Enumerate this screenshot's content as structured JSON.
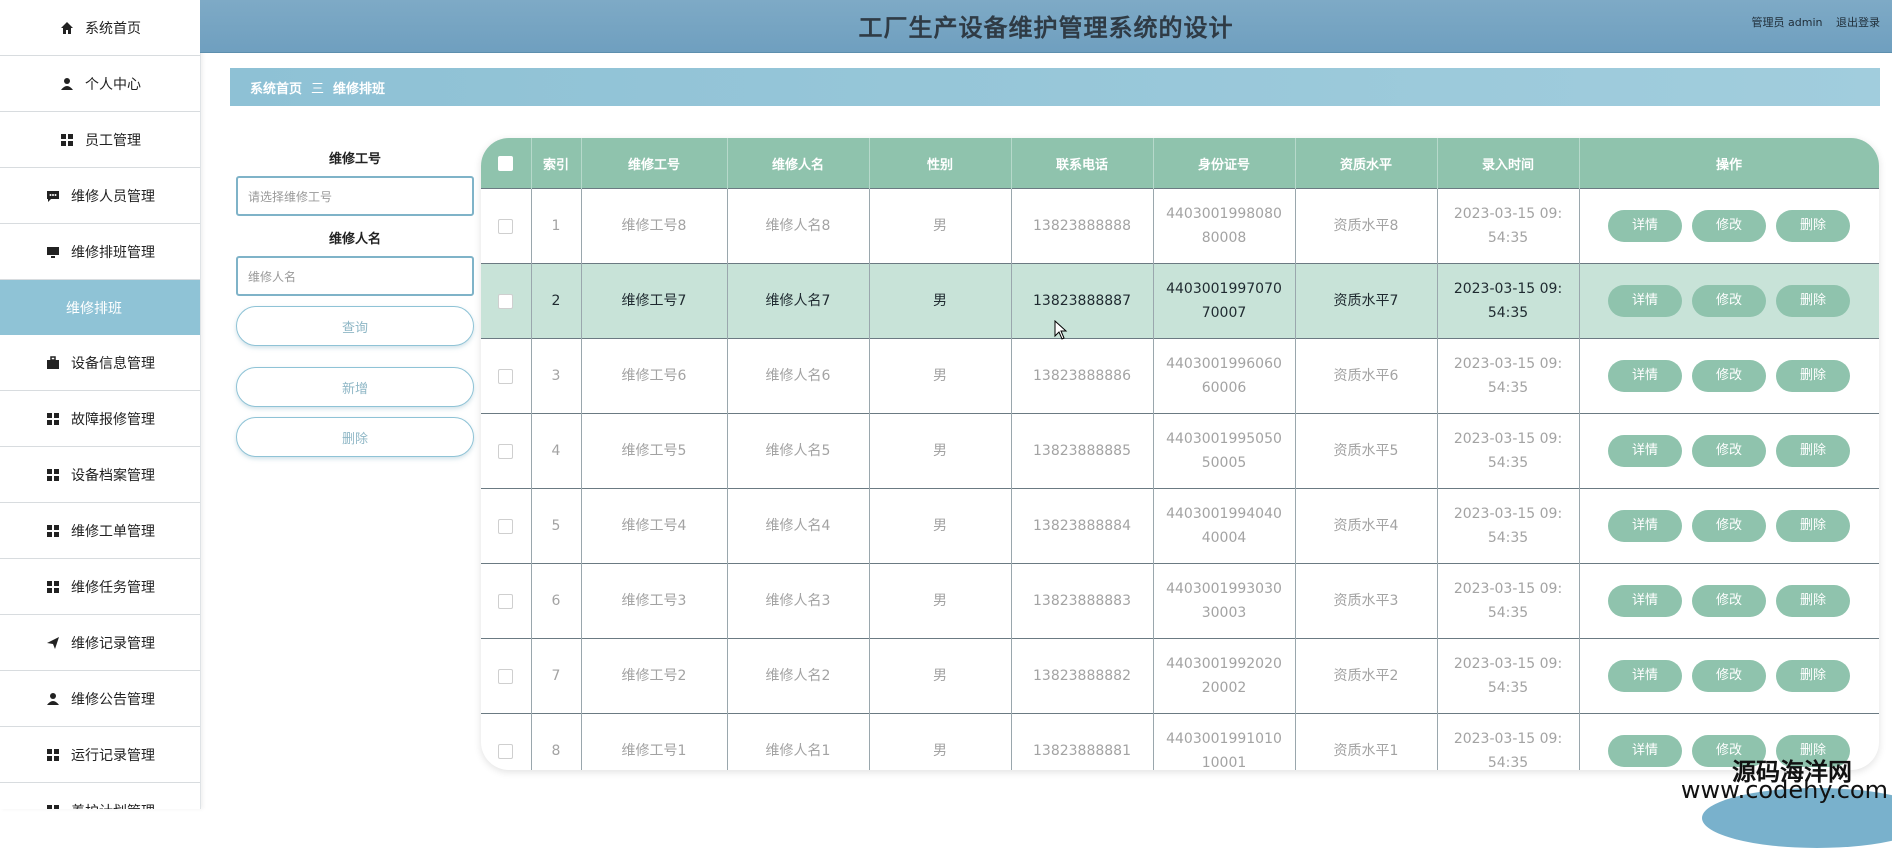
{
  "sidebar": {
    "items": [
      {
        "label": "系统首页",
        "icon": "home-icon"
      },
      {
        "label": "个人中心",
        "icon": "user-icon"
      },
      {
        "label": "员工管理",
        "icon": "grid-icon"
      },
      {
        "label": "维修人员管理",
        "icon": "chat-icon"
      },
      {
        "label": "维修排班管理",
        "icon": "monitor-icon"
      },
      {
        "label": "维修排班",
        "icon": "",
        "sub": true
      },
      {
        "label": "设备信息管理",
        "icon": "briefcase-icon"
      },
      {
        "label": "故障报修管理",
        "icon": "grid-icon"
      },
      {
        "label": "设备档案管理",
        "icon": "grid-icon"
      },
      {
        "label": "维修工单管理",
        "icon": "grid-icon"
      },
      {
        "label": "维修任务管理",
        "icon": "grid-icon"
      },
      {
        "label": "维修记录管理",
        "icon": "send-icon"
      },
      {
        "label": "维修公告管理",
        "icon": "user-icon"
      },
      {
        "label": "运行记录管理",
        "icon": "grid-icon"
      },
      {
        "label": "养护计划管理",
        "icon": "grid-icon"
      }
    ]
  },
  "header": {
    "title": "工厂生产设备维护管理系统的设计",
    "user_label": "管理员 admin",
    "logout_label": "退出登录"
  },
  "breadcrumb": {
    "home": "系统首页",
    "separator": "三",
    "current": "维修排班"
  },
  "search": {
    "field1_label": "维修工号",
    "field1_placeholder": "请选择维修工号",
    "field2_label": "维修人名",
    "field2_placeholder": "维修人名",
    "query_label": "查询",
    "add_label": "新增",
    "delete_label": "删除"
  },
  "table": {
    "headers": [
      "索引",
      "维修工号",
      "维修人名",
      "性别",
      "联系电话",
      "身份证号",
      "资质水平",
      "录入时间",
      "操作"
    ],
    "actions": {
      "detail": "详情",
      "edit": "修改",
      "delete": "删除"
    },
    "rows": [
      {
        "index": "1",
        "emp_no": "维修工号8",
        "name": "维修人名8",
        "gender": "男",
        "phone": "13823888888",
        "id_card": "440300199808080008",
        "level": "资质水平8",
        "time": "2023-03-15 09:54:35"
      },
      {
        "index": "2",
        "emp_no": "维修工号7",
        "name": "维修人名7",
        "gender": "男",
        "phone": "13823888887",
        "id_card": "440300199707070007",
        "level": "资质水平7",
        "time": "2023-03-15 09:54:35"
      },
      {
        "index": "3",
        "emp_no": "维修工号6",
        "name": "维修人名6",
        "gender": "男",
        "phone": "13823888886",
        "id_card": "440300199606060006",
        "level": "资质水平6",
        "time": "2023-03-15 09:54:35"
      },
      {
        "index": "4",
        "emp_no": "维修工号5",
        "name": "维修人名5",
        "gender": "男",
        "phone": "13823888885",
        "id_card": "440300199505050005",
        "level": "资质水平5",
        "time": "2023-03-15 09:54:35"
      },
      {
        "index": "5",
        "emp_no": "维修工号4",
        "name": "维修人名4",
        "gender": "男",
        "phone": "13823888884",
        "id_card": "440300199404040004",
        "level": "资质水平4",
        "time": "2023-03-15 09:54:35"
      },
      {
        "index": "6",
        "emp_no": "维修工号3",
        "name": "维修人名3",
        "gender": "男",
        "phone": "13823888883",
        "id_card": "440300199303030003",
        "level": "资质水平3",
        "time": "2023-03-15 09:54:35"
      },
      {
        "index": "7",
        "emp_no": "维修工号2",
        "name": "维修人名2",
        "gender": "男",
        "phone": "13823888882",
        "id_card": "440300199202020002",
        "level": "资质水平2",
        "time": "2023-03-15 09:54:35"
      },
      {
        "index": "8",
        "emp_no": "维修工号1",
        "name": "维修人名1",
        "gender": "男",
        "phone": "13823888881",
        "id_card": "440300199101010001",
        "level": "资质水平1",
        "time": "2023-03-15 09:54:35"
      }
    ]
  },
  "brand": {
    "name": "源码海洋网",
    "url": "www.codehy.com"
  },
  "colors": {
    "accent": "#8fc3ad",
    "header": "#7eaac6",
    "sidebar_active": "#8fc3d6"
  }
}
